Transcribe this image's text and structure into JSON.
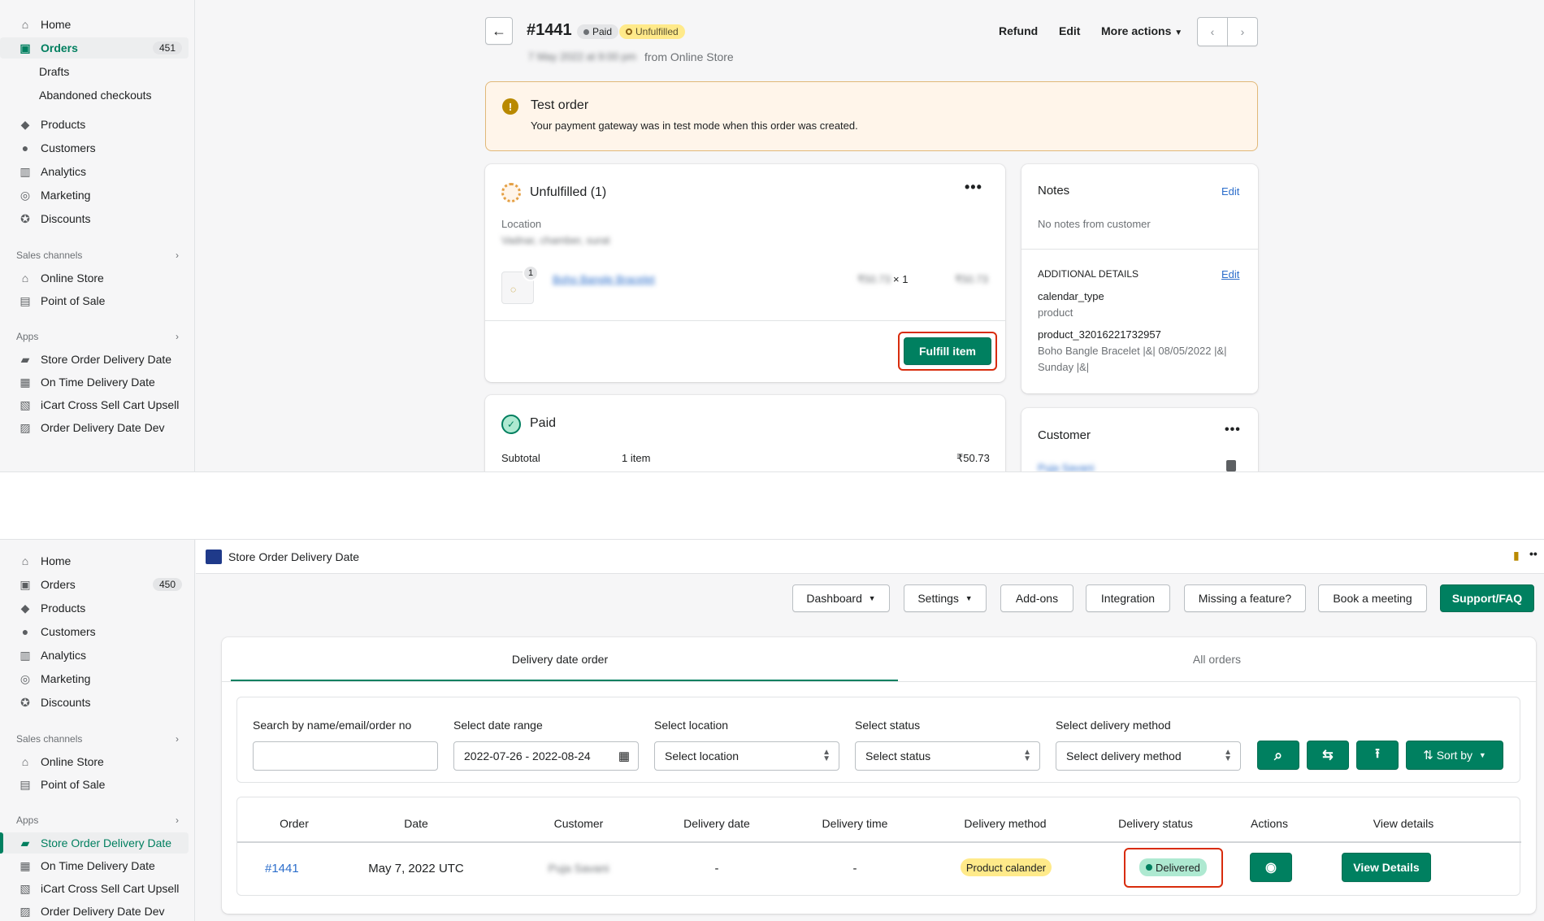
{
  "top": {
    "nav": [
      {
        "label": "Home",
        "icon": "home-icon"
      },
      {
        "label": "Orders",
        "icon": "orders-icon",
        "count": "451",
        "active": true
      },
      {
        "label": "Drafts",
        "sub": true
      },
      {
        "label": "Abandoned checkouts",
        "sub": true
      },
      {
        "label": "Products",
        "icon": "tag-icon"
      },
      {
        "label": "Customers",
        "icon": "person-icon"
      },
      {
        "label": "Analytics",
        "icon": "bar-chart-icon"
      },
      {
        "label": "Marketing",
        "icon": "target-icon"
      },
      {
        "label": "Discounts",
        "icon": "discount-icon"
      }
    ],
    "sales_channels_title": "Sales channels",
    "sales_channels": [
      {
        "label": "Online Store",
        "icon": "store-icon"
      },
      {
        "label": "Point of Sale",
        "icon": "pos-icon"
      }
    ],
    "apps_title": "Apps",
    "apps": [
      {
        "label": "Store Order Delivery Date",
        "icon": "truck-icon"
      },
      {
        "label": "On Time Delivery Date",
        "icon": "calendar-icon"
      },
      {
        "label": "iCart Cross Sell Cart Upsell",
        "icon": "app-icon"
      },
      {
        "label": "Order Delivery Date Dev",
        "icon": "app-icon"
      }
    ],
    "order": {
      "number": "#1441",
      "paid_badge": "Paid",
      "unfulfilled_badge": "Unfulfilled",
      "date_blurred": "7 May 2022 at 9:00 pm",
      "source": "from Online Store",
      "refund": "Refund",
      "edit": "Edit",
      "more_actions": "More actions"
    },
    "test_order": {
      "title": "Test order",
      "text": "Your payment gateway was in test mode when this order was created."
    },
    "unfulfilled": {
      "title": "Unfulfilled (1)",
      "location_label": "Location",
      "location_blurred": "Vadnar, chamber, surat",
      "item_qty_badge": "1",
      "item_name_blurred": "Boho Bangle Bracelet",
      "unit_price_blurred": "₹50.73",
      "times": "× 1",
      "line_total_blurred": "₹50.73",
      "fulfill_button": "Fulfill item"
    },
    "paid": {
      "title": "Paid",
      "subtotal_label": "Subtotal",
      "subtotal_items": "1 item",
      "subtotal_value": "₹50.73"
    },
    "notes": {
      "title": "Notes",
      "edit": "Edit",
      "text": "No notes from customer",
      "additional_title": "ADDITIONAL DETAILS",
      "additional_edit": "Edit",
      "key1": "calendar_type",
      "val1": "product",
      "key2": "product_32016221732957",
      "val2_line1": "Boho Bangle Bracelet |&| 08/05/2022 |&|",
      "val2_line2": "Sunday |&|"
    },
    "customer": {
      "title": "Customer",
      "name_blurred": "Puja Savani"
    }
  },
  "bottom": {
    "nav": [
      {
        "label": "Home",
        "icon": "home-icon"
      },
      {
        "label": "Orders",
        "icon": "orders-icon",
        "count": "450"
      },
      {
        "label": "Products",
        "icon": "tag-icon"
      },
      {
        "label": "Customers",
        "icon": "person-icon"
      },
      {
        "label": "Analytics",
        "icon": "bar-chart-icon"
      },
      {
        "label": "Marketing",
        "icon": "target-icon"
      },
      {
        "label": "Discounts",
        "icon": "discount-icon"
      }
    ],
    "sales_channels_title": "Sales channels",
    "sales_channels": [
      {
        "label": "Online Store",
        "icon": "store-icon"
      },
      {
        "label": "Point of Sale",
        "icon": "pos-icon"
      }
    ],
    "apps_title": "Apps",
    "apps": [
      {
        "label": "Store Order Delivery Date",
        "icon": "truck-icon",
        "active": true
      },
      {
        "label": "On Time Delivery Date",
        "icon": "calendar-icon"
      },
      {
        "label": "iCart Cross Sell Cart Upsell",
        "icon": "app-icon"
      },
      {
        "label": "Order Delivery Date Dev",
        "icon": "app-icon"
      }
    ],
    "app_title": "Store Order Delivery Date",
    "toolbar": {
      "dashboard": "Dashboard",
      "settings": "Settings",
      "addons": "Add-ons",
      "integration": "Integration",
      "missing": "Missing a feature?",
      "book": "Book a meeting",
      "support": "Support/FAQ"
    },
    "tabs": {
      "delivery": "Delivery date order",
      "all": "All orders"
    },
    "filters": {
      "search_label": "Search by name/email/order no",
      "search_value": "",
      "date_label": "Select date range",
      "date_value": "2022-07-26 - 2022-08-24",
      "location_label": "Select location",
      "location_value": "Select location",
      "status_label": "Select status",
      "status_value": "Select status",
      "method_label": "Select delivery method",
      "method_value": "Select delivery method",
      "sort_by": "Sort by"
    },
    "table": {
      "headers": [
        "Order",
        "Date",
        "Customer",
        "Delivery date",
        "Delivery time",
        "Delivery method",
        "Delivery status",
        "Actions",
        "View details"
      ],
      "row": {
        "order": "#1441",
        "date": "May 7, 2022 UTC",
        "customer_blurred": "Puja Savani",
        "delivery_date": "-",
        "delivery_time": "-",
        "method": "Product calander",
        "status": "Delivered",
        "view": "View Details"
      }
    }
  },
  "colors": {
    "accent": "#008060",
    "highlight": "#d82c0d",
    "warning": "#ffd79d",
    "link": "#2c6ecb"
  }
}
